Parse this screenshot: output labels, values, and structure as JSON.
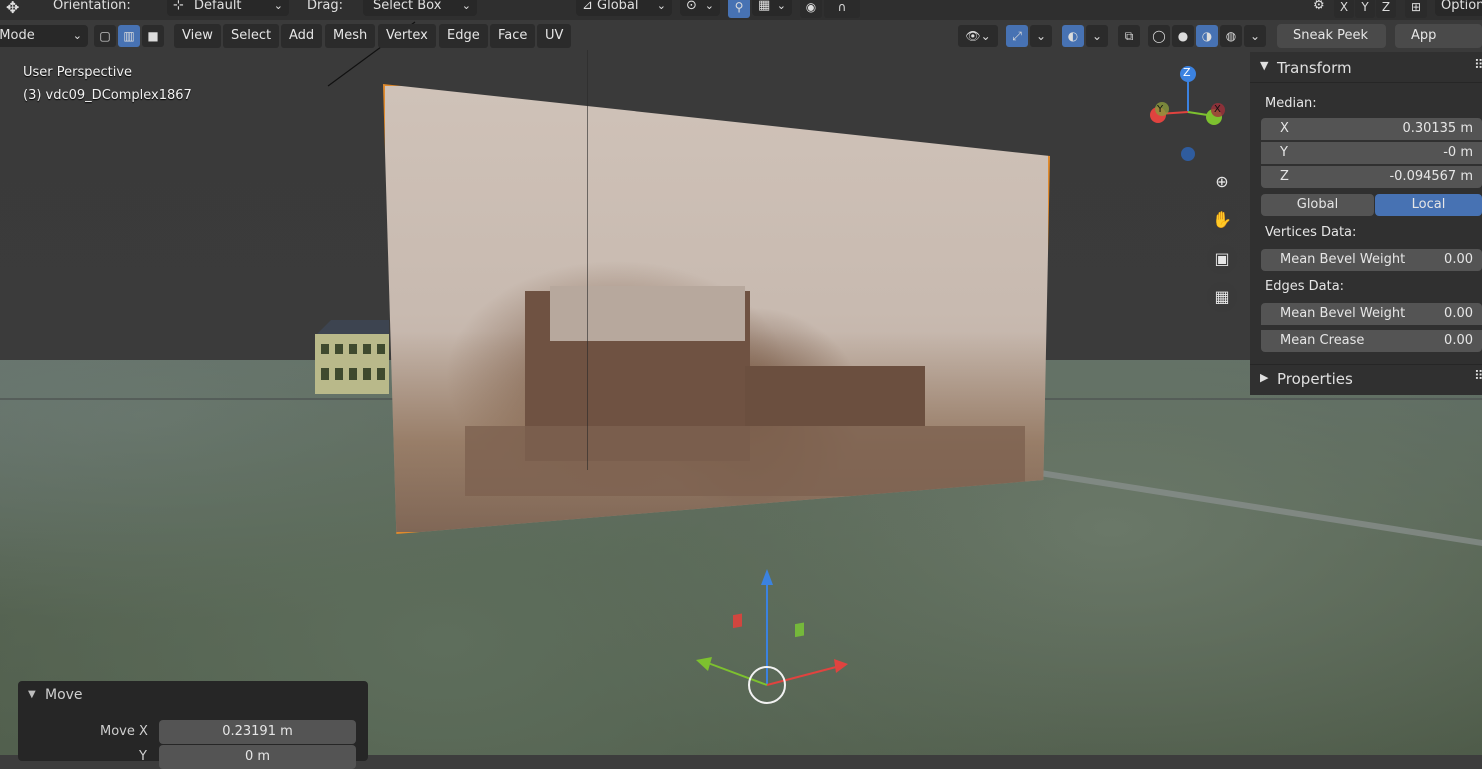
{
  "header_top": {
    "orientation_label": "Orientation:",
    "orientation_value": "Default",
    "drag_label": "Drag:",
    "drag_value": "Select Box",
    "transform_space": "Global",
    "axis_x": "X",
    "axis_y": "Y",
    "axis_z": "Z",
    "options": "Options"
  },
  "header_menu": {
    "mode": "Edit Mode",
    "items": [
      "View",
      "Select",
      "Add",
      "Mesh",
      "Vertex",
      "Edge",
      "Face",
      "UV"
    ],
    "sneak_peek": "Sneak Peek",
    "app_manager": "App Manager"
  },
  "viewport": {
    "perspective": "User Perspective",
    "object": "(3) vdc09_DComplex1867"
  },
  "gizmo": {
    "x": "X",
    "y": "Y",
    "z": "Z"
  },
  "transform_panel": {
    "title": "Transform",
    "median_label": "Median:",
    "fields": [
      {
        "label": "X",
        "value": "0.30135 m"
      },
      {
        "label": "Y",
        "value": "-0 m"
      },
      {
        "label": "Z",
        "value": "-0.094567 m"
      }
    ],
    "global": "Global",
    "local": "Local",
    "vertices_data": "Vertices Data:",
    "vertex_bevel": {
      "label": "Mean Bevel Weight",
      "value": "0.00"
    },
    "edges_data": "Edges Data:",
    "edge_bevel": {
      "label": "Mean Bevel Weight",
      "value": "0.00"
    },
    "edge_crease": {
      "label": "Mean Crease",
      "value": "0.00"
    },
    "properties": "Properties"
  },
  "operator_panel": {
    "title": "Move",
    "move_x_label": "Move X",
    "move_x_value": "0.23191 m",
    "next_label": "Y",
    "next_value": "0 m"
  },
  "colors": {
    "accent": "#4772b3",
    "selection_outline": "#e08a2c",
    "axis_x": "#e0433f",
    "axis_y": "#7dc12f",
    "axis_z": "#3b82e0"
  }
}
